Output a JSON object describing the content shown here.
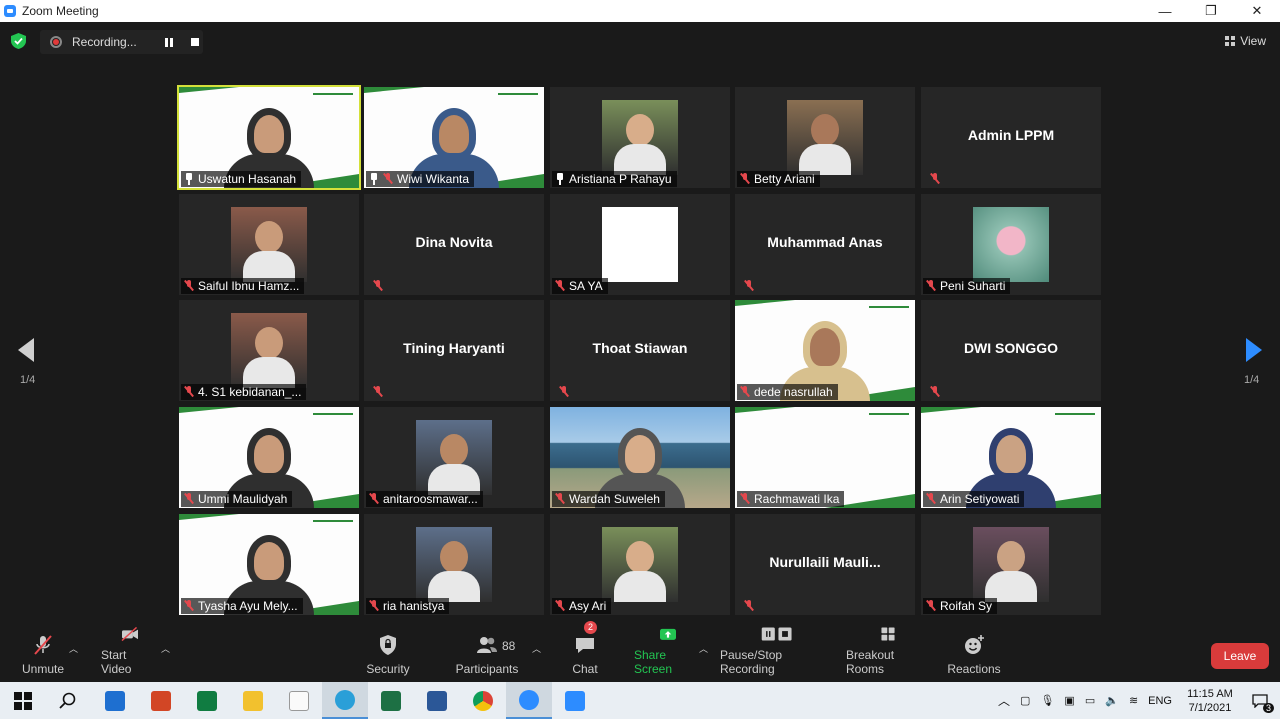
{
  "window": {
    "title": "Zoom Meeting",
    "minimize": "—",
    "restore": "❐",
    "close": "✕"
  },
  "topbar": {
    "recording_label": "Recording...",
    "view_label": "View"
  },
  "pagination": {
    "left": "1/4",
    "right": "1/4"
  },
  "participants_grid": [
    {
      "name": "Uswatun Hasanah",
      "type": "video-slide",
      "active": true,
      "pinned": true
    },
    {
      "name": "Wiwi Wikanta",
      "type": "video-slide",
      "muted": true,
      "pinned": true
    },
    {
      "name": "Aristiana P Rahayu",
      "type": "photo",
      "pinned": true
    },
    {
      "name": "Betty Ariani",
      "type": "photo",
      "muted": true
    },
    {
      "name": "Admin LPPM",
      "type": "name-only",
      "muted": true
    },
    {
      "name": "Saiful Ibnu Hamz...",
      "type": "photo",
      "muted": true
    },
    {
      "name": "Dina Novita",
      "type": "name-only",
      "muted": true
    },
    {
      "name": "SA YA",
      "type": "photo-white",
      "muted": true
    },
    {
      "name": "Muhammad Anas",
      "type": "name-only",
      "muted": true
    },
    {
      "name": "Peni Suharti",
      "type": "photo-flower",
      "muted": true
    },
    {
      "name": "4. S1 kebidanan_...",
      "type": "photo",
      "muted": true
    },
    {
      "name": "Tining Haryanti",
      "type": "name-only",
      "muted": true
    },
    {
      "name": "Thoat Stiawan",
      "type": "name-only",
      "muted": true
    },
    {
      "name": "dede nasrullah",
      "type": "video-slide",
      "muted": true
    },
    {
      "name": "DWI SONGGO",
      "type": "name-only",
      "muted": true
    },
    {
      "name": "Ummi Maulidyah",
      "type": "video-slide",
      "muted": true
    },
    {
      "name": "anitaroosmawar...",
      "type": "photo",
      "muted": true
    },
    {
      "name": "Wardah Suweleh",
      "type": "video-scene",
      "muted": true
    },
    {
      "name": "Rachmawati Ika",
      "type": "video-slide-empty",
      "muted": true
    },
    {
      "name": "Arin Setiyowati",
      "type": "video-slide",
      "muted": true
    },
    {
      "name": "Tyasha Ayu Mely...",
      "type": "video-slide",
      "muted": true
    },
    {
      "name": "ria hanistya",
      "type": "photo",
      "muted": true
    },
    {
      "name": "Asy Ari",
      "type": "photo",
      "muted": true
    },
    {
      "name": "Nurullaili  Mauli...",
      "type": "name-only",
      "muted": true
    },
    {
      "name": "Roifah Sy",
      "type": "photo",
      "muted": true
    }
  ],
  "toolbar": {
    "unmute": "Unmute",
    "start_video": "Start Video",
    "security": "Security",
    "participants": "Participants",
    "participants_count": "88",
    "chat": "Chat",
    "chat_badge": "2",
    "share_screen": "Share Screen",
    "pause_stop_recording": "Pause/Stop Recording",
    "breakout_rooms": "Breakout Rooms",
    "reactions": "Reactions",
    "leave": "Leave"
  },
  "taskbar": {
    "language": "ENG",
    "time": "11:15 AM",
    "date": "7/1/2021",
    "notification_count": "3",
    "apps": [
      "start-icon",
      "search-icon",
      "mail-icon",
      "powerpoint-icon",
      "publisher-icon",
      "file-explorer-icon",
      "notepad-icon",
      "edge-icon",
      "excel-icon",
      "word-icon",
      "chrome-icon",
      "zoom-icon",
      "zoom-meeting-icon"
    ]
  },
  "colors": {
    "accent_blue": "#2d8cff",
    "active_speaker": "#d4e03a",
    "leave_red": "#d93b3b",
    "share_green": "#23c552",
    "slide_green": "#2e8b3a"
  }
}
